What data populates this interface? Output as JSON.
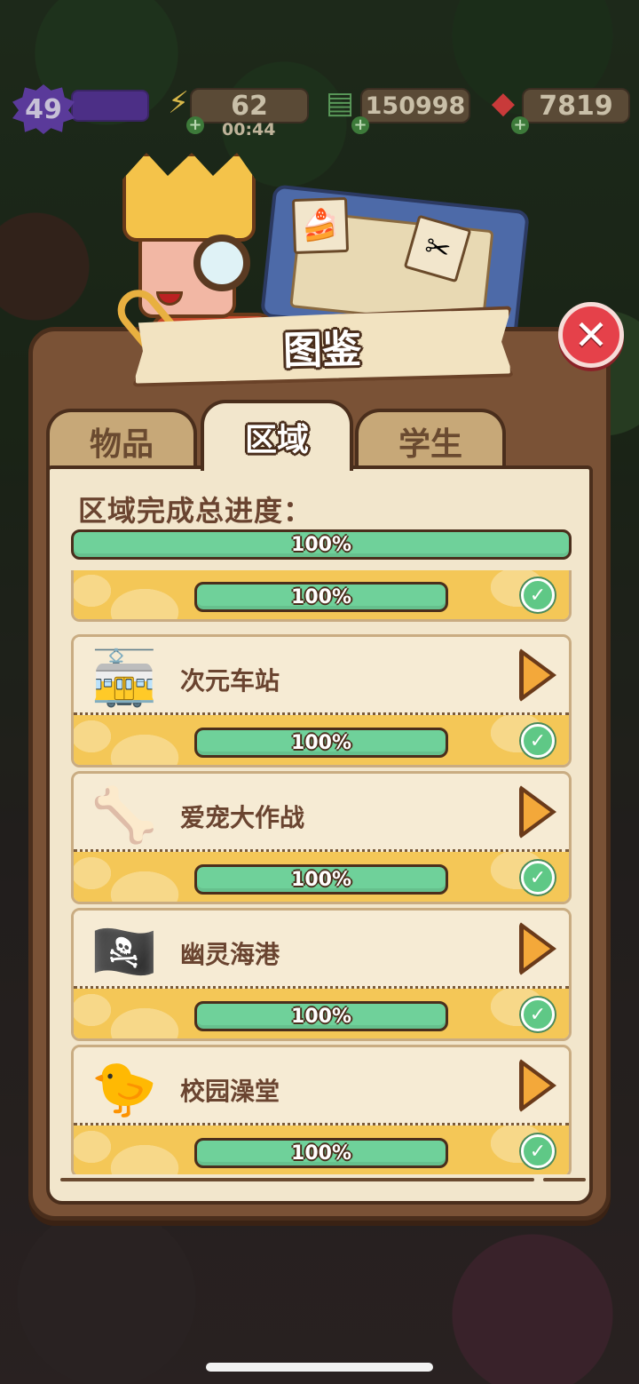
{
  "hud": {
    "level": "49",
    "energy": "62",
    "energy_timer": "00:44",
    "cash": "150998",
    "gems": "7819",
    "energy_icon": "lightning-icon",
    "cash_icon": "cash-stack-icon",
    "gem_icon": "ruby-icon"
  },
  "panel": {
    "title": "图鉴",
    "tabs": [
      {
        "label": "物品",
        "active": false
      },
      {
        "label": "区域",
        "active": true
      },
      {
        "label": "学生",
        "active": false
      }
    ],
    "overall_label": "区域完成总进度：",
    "overall_progress": 1.0,
    "overall_progress_text": "100%"
  },
  "zones": [
    {
      "name": "",
      "icon": "partial-zone-icon",
      "progress": 1.0,
      "progress_text": "100%",
      "complete": true,
      "partial": true
    },
    {
      "name": "次元车站",
      "icon": "train-station-icon",
      "progress": 1.0,
      "progress_text": "100%",
      "complete": true
    },
    {
      "name": "爱宠大作战",
      "icon": "dog-bone-icon",
      "progress": 1.0,
      "progress_text": "100%",
      "complete": true
    },
    {
      "name": "幽灵海港",
      "icon": "pirate-hat-icon",
      "progress": 1.0,
      "progress_text": "100%",
      "complete": true
    },
    {
      "name": "校园澡堂",
      "icon": "rubber-duck-icon",
      "progress": 1.0,
      "progress_text": "100%",
      "complete": true
    }
  ],
  "colors": {
    "progress_fill": "#6fd19a",
    "close_button": "#e5414a",
    "panel_frame": "#7a5236",
    "content_bg": "#f2e6cc"
  }
}
